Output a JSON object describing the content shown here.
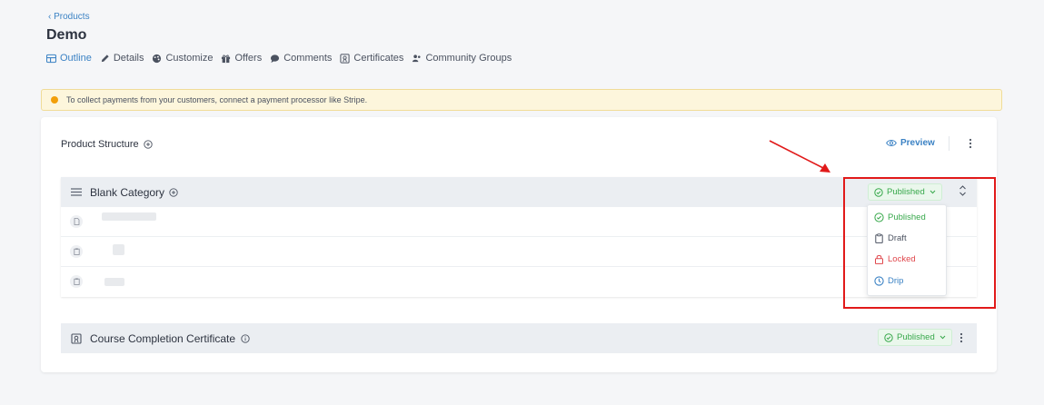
{
  "breadcrumb": {
    "back_label": "‹ Products"
  },
  "page": {
    "title": "Demo"
  },
  "tabs": [
    {
      "label": "Outline",
      "icon": "outline-icon",
      "active": true
    },
    {
      "label": "Details",
      "icon": "pencil-icon",
      "active": false
    },
    {
      "label": "Customize",
      "icon": "palette-icon",
      "active": false
    },
    {
      "label": "Offers",
      "icon": "gift-icon",
      "active": false
    },
    {
      "label": "Comments",
      "icon": "comment-icon",
      "active": false
    },
    {
      "label": "Certificates",
      "icon": "certificate-icon",
      "active": false
    },
    {
      "label": "Community Groups",
      "icon": "users-icon",
      "active": false
    }
  ],
  "alert": {
    "text": "To collect payments from your customers, connect a payment processor like Stripe."
  },
  "structure": {
    "title": "Product Structure",
    "preview_label": "Preview"
  },
  "category": {
    "name": "Blank Category",
    "status": "Published"
  },
  "status_menu": {
    "items": [
      {
        "label": "Published",
        "icon": "check-circle-icon",
        "color": "#37a84b"
      },
      {
        "label": "Draft",
        "icon": "clipboard-icon",
        "color": "#4b5260"
      },
      {
        "label": "Locked",
        "icon": "lock-icon",
        "color": "#e0474c"
      },
      {
        "label": "Drip",
        "icon": "clock-icon",
        "color": "#3b82c4"
      }
    ]
  },
  "certificate": {
    "name": "Course Completion Certificate",
    "status": "Published"
  },
  "colors": {
    "accent": "#3b82c4",
    "published": "#37a84b",
    "locked": "#e0474c",
    "highlight": "#e11a1a"
  }
}
